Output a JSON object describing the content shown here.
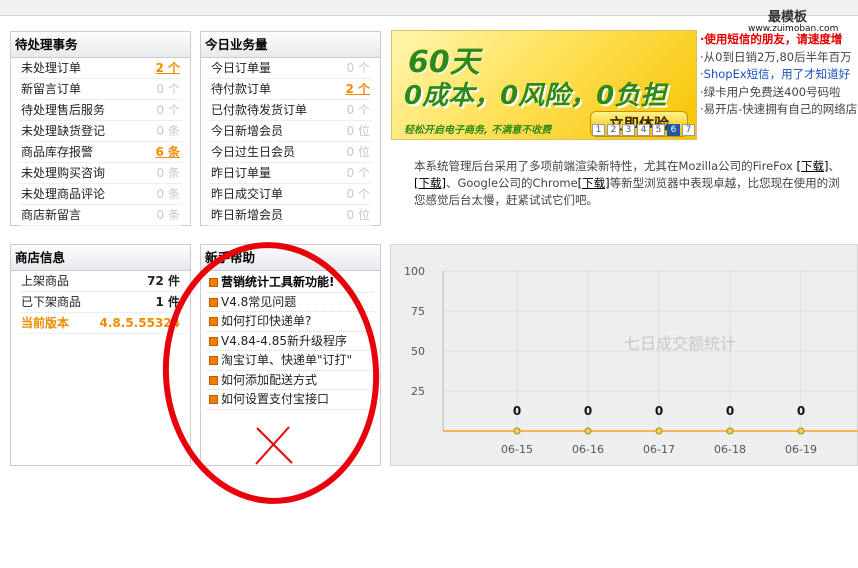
{
  "brand": {
    "name": "最模板",
    "url": "www.zuimoban.com"
  },
  "pending": {
    "title": "待处理事务",
    "rows": [
      {
        "label": "未处理订单",
        "value": "2 个",
        "hot": true
      },
      {
        "label": "新留言订单",
        "value": "0 个"
      },
      {
        "label": "待处理售后服务",
        "value": "0 个"
      },
      {
        "label": "未处理缺货登记",
        "value": "0 条"
      },
      {
        "label": "商品库存报警",
        "value": "6 条",
        "hot": true
      },
      {
        "label": "未处理购买咨询",
        "value": "0 条"
      },
      {
        "label": "未处理商品评论",
        "value": "0 条"
      },
      {
        "label": "商店新留言",
        "value": "0 条"
      }
    ]
  },
  "today": {
    "title": "今日业务量",
    "rows": [
      {
        "label": "今日订单量",
        "value": "0 个"
      },
      {
        "label": "待付款订单",
        "value": "2 个",
        "hot": true
      },
      {
        "label": "已付款待发货订单",
        "value": "0 个"
      },
      {
        "label": "今日新增会员",
        "value": "0 位"
      },
      {
        "label": "今日过生日会员",
        "value": "0 位"
      },
      {
        "label": "昨日订单量",
        "value": "0 个"
      },
      {
        "label": "昨日成交订单",
        "value": "0 个"
      },
      {
        "label": "昨日新增会员",
        "value": "0 位"
      }
    ]
  },
  "shop": {
    "title": "商店信息",
    "rows": [
      {
        "label": "上架商品",
        "value": "72 件"
      },
      {
        "label": "已下架商品",
        "value": "1 件"
      },
      {
        "label": "当前版本",
        "value": "4.8.5.55324"
      }
    ]
  },
  "help": {
    "title": "新手帮助",
    "items": [
      "营销统计工具新功能!",
      "V4.8常见问题",
      "如何打印快递单?",
      "V4.84-4.85新升级程序",
      "淘宝订单、快递单\"订打\"",
      "如何添加配送方式",
      "如何设置支付宝接口"
    ]
  },
  "banner": {
    "days": "60天",
    "slogan": "0成本，0风险，0负担",
    "sub": "轻松开启电子商务, 不满意不收费",
    "cta": "立即体验",
    "pages": [
      "1",
      "2",
      "3",
      "4",
      "5",
      "6",
      "7"
    ],
    "active_page": "6"
  },
  "news": [
    "·使用短信的朋友，请速度增",
    "·从0到日销2万,80后半年百万",
    "·ShopEx短信，用了才知道好",
    "·绿卡用户免费送400号码啦",
    "·易开店-快速拥有自己的网络店"
  ],
  "intro": {
    "text1": "本系统管理后台采用了多项前端渲染新特性，尤其在Mozilla公司的FireFox ",
    "link1": "[下载]",
    "text2": "、",
    "link2": "[下载]",
    "text3": "、Google公司的Chrome",
    "link3": "[下载]",
    "text4": "等新型浏览器中表现卓越，比您现在使用的浏",
    "text5": "您感觉后台太慢，赶紧试试它们吧。"
  },
  "chart_data": {
    "type": "line",
    "title": "七日成交额统计",
    "categories": [
      "06-15",
      "06-16",
      "06-17",
      "06-18",
      "06-19"
    ],
    "values": [
      0,
      0,
      0,
      0,
      0
    ],
    "data_labels": [
      "0",
      "0",
      "0",
      "0",
      "0"
    ],
    "y_ticks": [
      "100",
      "75",
      "50",
      "25"
    ],
    "ylim": [
      0,
      100
    ],
    "grid": true,
    "line_color": "#f6a623"
  },
  "annotation": {
    "color": "#e8000b",
    "mark": "X"
  }
}
